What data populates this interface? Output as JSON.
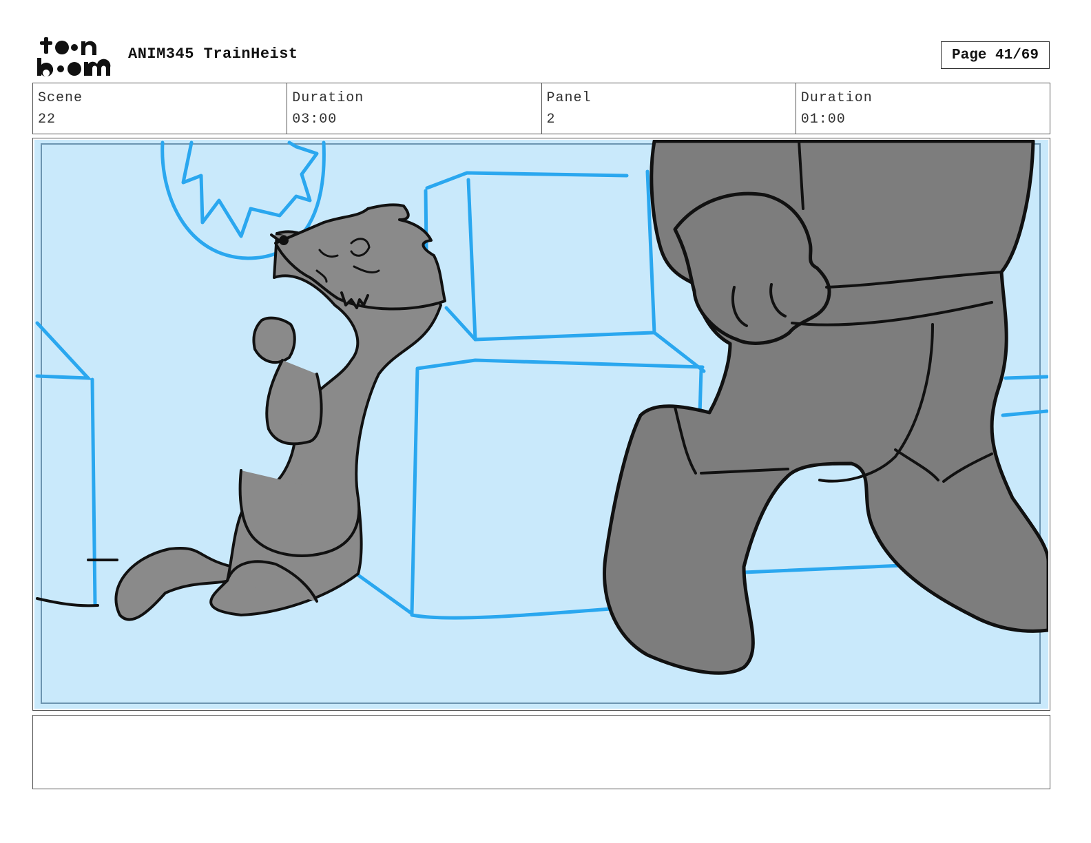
{
  "header": {
    "logo_text": "toon boom",
    "project_title": "ANIM345 TrainHeist",
    "page_label": "Page 41/69"
  },
  "info": {
    "scene_label": "Scene",
    "scene_value": "22",
    "scene_duration_label": "Duration",
    "scene_duration_value": "03:00",
    "panel_label": "Panel",
    "panel_value": "2",
    "panel_duration_label": "Duration",
    "panel_duration_value": "01:00"
  },
  "panel": {
    "background_color": "#c9e9fb",
    "line_color": "#2aa7ef",
    "character_fill": "#8a8a8a",
    "character_dark_fill": "#7d7d7d"
  },
  "notes": {
    "text": ""
  }
}
